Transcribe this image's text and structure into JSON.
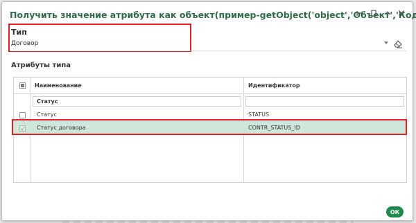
{
  "dialog": {
    "title": "Получить значение атрибута как объект(пример-getObject('object','Объект','Код'))",
    "controls": [
      "minimize-icon",
      "restore-icon",
      "collapse-icon",
      "close-icon"
    ]
  },
  "type_field": {
    "label": "Тип",
    "value": "Договор"
  },
  "attributes": {
    "section_label": "Атрибуты типа",
    "columns": [
      "Наименование",
      "Идентификатор"
    ],
    "group_header": "Статус",
    "rows": [
      {
        "name": "Статус",
        "id": "STATUS",
        "checked": false,
        "selected": false
      },
      {
        "name": "Статус договора",
        "id": "CONTR_STATUS_ID",
        "checked": true,
        "selected": true
      }
    ]
  },
  "footer": {
    "ok_label": "ОК"
  },
  "colors": {
    "title": "#2f6b4a",
    "selected_row": "#cfe6da",
    "highlight_border": "#e02020",
    "ok_button": "#1f8a4c"
  }
}
